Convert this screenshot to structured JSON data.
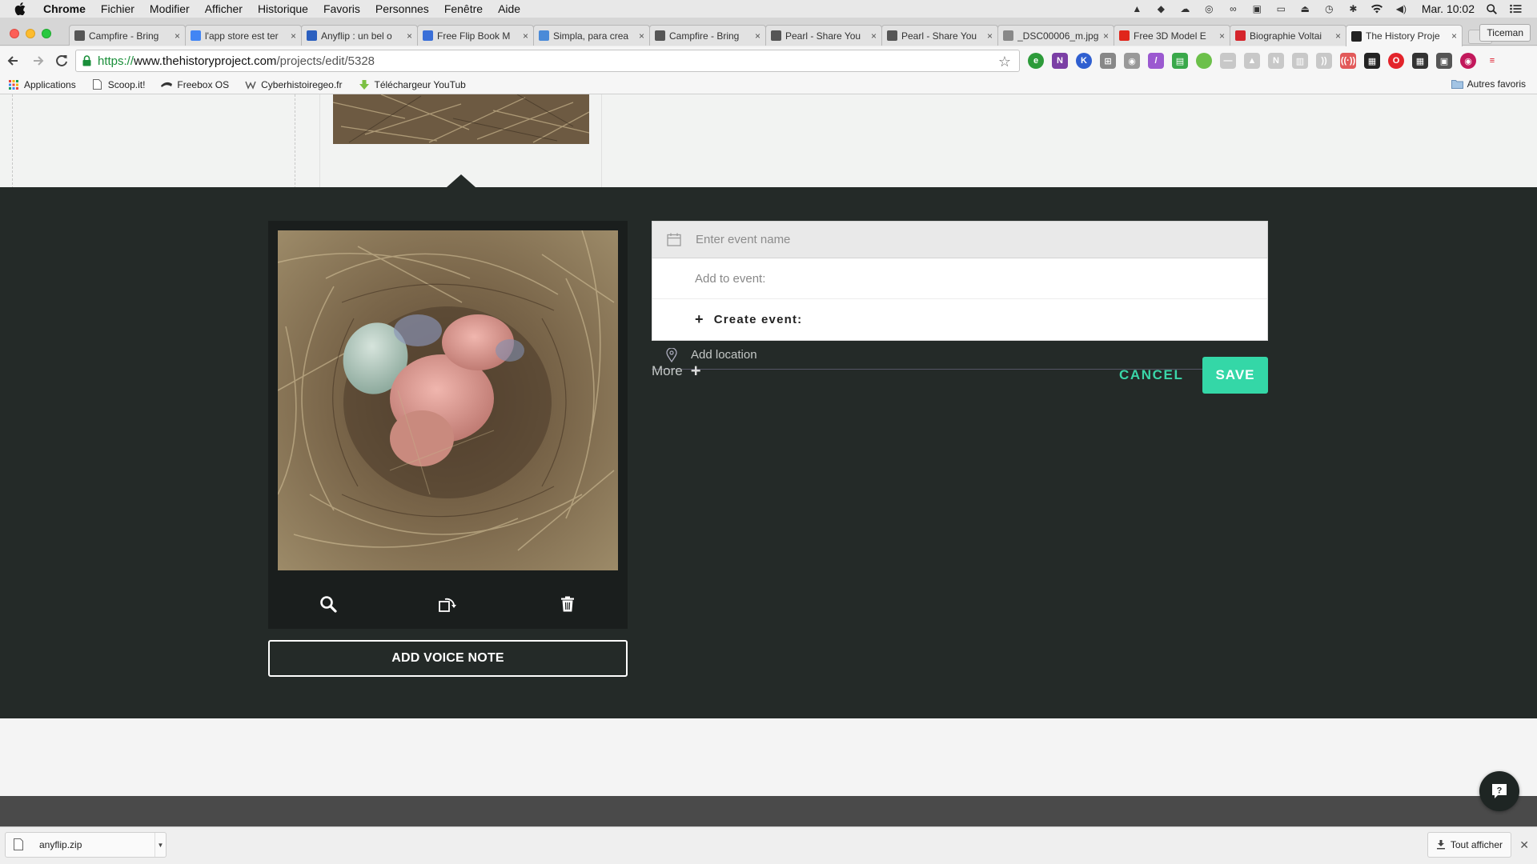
{
  "menubar": {
    "app_name": "Chrome",
    "items": [
      "Fichier",
      "Modifier",
      "Afficher",
      "Historique",
      "Favoris",
      "Personnes",
      "Fenêtre",
      "Aide"
    ],
    "clock": "Mar. 10:02"
  },
  "tabs": [
    {
      "title": "Campfire - Bring",
      "icon": "apple-icon",
      "color": "#555555"
    },
    {
      "title": "l'app store est ter",
      "icon": "google-icon",
      "color": "#4285f4"
    },
    {
      "title": "Anyflip : un bel o",
      "icon": "anyflip-icon",
      "color": "#2b5fbf"
    },
    {
      "title": "Free Flip Book M",
      "icon": "flipbook-icon",
      "color": "#3a6fd8"
    },
    {
      "title": "Simpla, para crea",
      "icon": "simpla-icon",
      "color": "#4a8ad8"
    },
    {
      "title": "Campfire - Bring",
      "icon": "apple-icon",
      "color": "#555555"
    },
    {
      "title": "Pearl - Share You",
      "icon": "apple-icon",
      "color": "#555555"
    },
    {
      "title": "Pearl - Share You",
      "icon": "apple-icon",
      "color": "#555555"
    },
    {
      "title": "_DSC00006_m.jpg",
      "icon": "file-icon",
      "color": "#888888"
    },
    {
      "title": "Free 3D Model E",
      "icon": "heart-icon",
      "color": "#e0261b"
    },
    {
      "title": "Biographie Voltai",
      "icon": "biography-icon",
      "color": "#d5242b"
    },
    {
      "title": "The History Proje",
      "icon": "history-project-icon",
      "color": "#222222"
    }
  ],
  "profile_name": "Ticeman",
  "address": {
    "scheme": "https://",
    "host": "www.thehistoryproject.com",
    "path": "/projects/edit/5328"
  },
  "bookmarks": [
    {
      "label": "Applications",
      "icon": "apps-grid-icon"
    },
    {
      "label": "Scoop.it!",
      "icon": "page-icon"
    },
    {
      "label": "Freebox OS",
      "icon": "freebox-icon"
    },
    {
      "label": "Cyberhistoiregeo.fr",
      "icon": "cyberhistoire-icon"
    },
    {
      "label": "Téléchargeur YouTub",
      "icon": "download-icon"
    }
  ],
  "bookmarks_other": "Autres favoris",
  "editor": {
    "event_name_placeholder": "Enter event name",
    "add_to_event": "Add to event:",
    "create_event": "Create event:",
    "add_location": "Add location",
    "more_label": "More",
    "cancel_label": "CANCEL",
    "save_label": "SAVE",
    "voice_note_label": "ADD VOICE NOTE"
  },
  "colors": {
    "accent": "#34d7a7",
    "editor_bg": "#242a28"
  },
  "downloads": {
    "file_name": "anyflip.zip",
    "show_all": "Tout afficher"
  }
}
